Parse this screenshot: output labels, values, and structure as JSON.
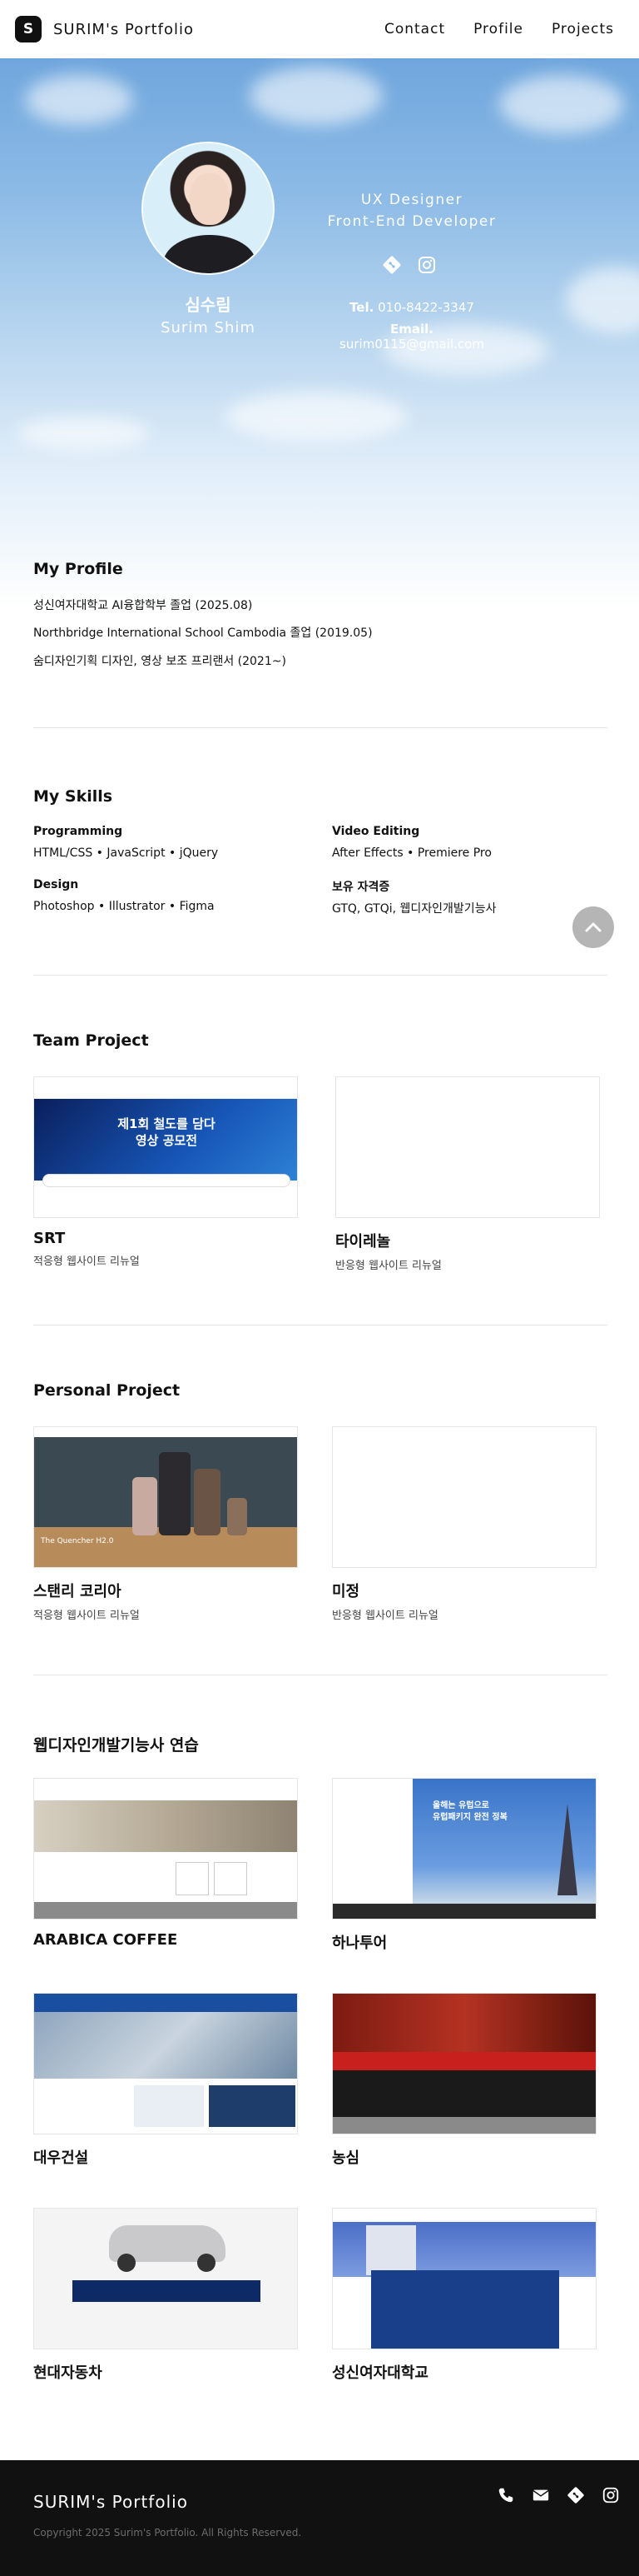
{
  "header": {
    "logo_letter": "S",
    "logo_text": "SURIM's Portfolio",
    "nav": [
      "Contact",
      "Profile",
      "Projects"
    ]
  },
  "hero": {
    "name_ko": "심수림",
    "name_en": "Surim Shim",
    "role1": "UX Designer",
    "role2": "Front-End Developer",
    "tel_label": "Tel.",
    "tel": "010-8422-3347",
    "email_label": "Email.",
    "email": "surim0115@gmail.com",
    "icons": [
      "git-icon",
      "instagram-icon"
    ]
  },
  "profile": {
    "title": "My Profile",
    "items": [
      "성신여자대학교 AI융합학부 졸업 (2025.08)",
      "Northbridge International School Cambodia 졸업 (2019.05)",
      "숨디자인기획 디자인, 영상 보조 프리랜서 (2021~)"
    ]
  },
  "skills": {
    "title": "My Skills",
    "groups": [
      {
        "h": "Programming",
        "v": "HTML/CSS • JavaScript • jQuery"
      },
      {
        "h": "Video Editing",
        "v": "After Effects • Premiere Pro"
      },
      {
        "h": "Design",
        "v": "Photoshop • Illustrator • Figma"
      },
      {
        "h": "보유 자격증",
        "v": "GTQ, GTQi, 웹디자인개발기능사"
      }
    ]
  },
  "team": {
    "title": "Team Project",
    "cards": [
      {
        "title": "SRT",
        "sub": "적응형 웹사이트 리뉴얼",
        "thumb_text": "제1회 철도를 담다\n영상 공모전"
      },
      {
        "title": "타이레놀",
        "sub": "반응형 웹사이트 리뉴얼"
      }
    ]
  },
  "personal": {
    "title": "Personal Project",
    "cards": [
      {
        "title": "스탠리 코리아",
        "sub": "적응형 웹사이트 리뉴얼",
        "thumb_text": "The Quencher H2.0"
      },
      {
        "title": "미정",
        "sub": "반응형 웹사이트 리뉴얼"
      }
    ]
  },
  "practice": {
    "title": "웹디자인개발기능사 연습",
    "cards": [
      {
        "title": "ARABICA COFFEE"
      },
      {
        "title": "하나투어"
      },
      {
        "title": "대우건설"
      },
      {
        "title": "농심"
      },
      {
        "title": "현대자동차"
      },
      {
        "title": "성신여자대학교"
      }
    ],
    "thumb_texts": {
      "hana": "올해는 유럽으로\n유럽패키지 완전 정복"
    }
  },
  "footer": {
    "logo": "SURIM's Portfolio",
    "copy": "Copyright 2025 Surim's Portfolio. All Rights Reserved.",
    "icons": [
      "phone-icon",
      "mail-icon",
      "git-icon",
      "instagram-icon"
    ]
  },
  "colors": {
    "hero_sky": "#7fb1e2",
    "footer": "#111111",
    "top_btn": "#b5b5b5"
  }
}
